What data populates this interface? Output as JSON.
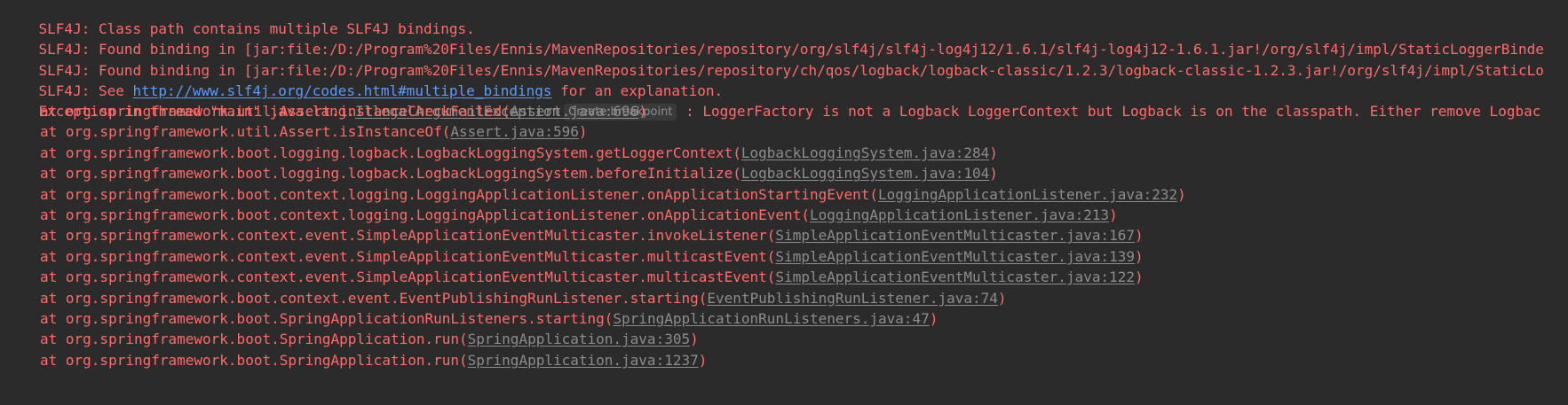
{
  "console": {
    "slf4j_lines": [
      "SLF4J: Class path contains multiple SLF4J bindings.",
      "SLF4J: Found binding in [jar:file:/D:/Program%20Files/Ennis/MavenRepositories/repository/org/slf4j/slf4j-log4j12/1.6.1/slf4j-log4j12-1.6.1.jar!/org/slf4j/impl/StaticLoggerBinde",
      "SLF4J: Found binding in [jar:file:/D:/Program%20Files/Ennis/MavenRepositories/repository/ch/qos/logback/logback-classic/1.2.3/logback-classic-1.2.3.jar!/org/slf4j/impl/StaticLo"
    ],
    "see_line": {
      "prefix": "SLF4J: See ",
      "url": "http://www.slf4j.org/codes.html#multiple_bindings",
      "suffix": " for an explanation."
    },
    "exception": {
      "prefix": "Exception in thread \"main\" java.lang.",
      "class_link": "IllegalArgumentException",
      "breakpoint_hint": "Create breakpoint",
      "message": " : LoggerFactory is not a Logback LoggerContext but Logback is on the classpath. Either remove Logbac"
    },
    "stack": [
      {
        "method": "at org.springframework.util.Assert.instanceCheckFailed(",
        "source": "Assert.java:696",
        "close": ")"
      },
      {
        "method": "at org.springframework.util.Assert.isInstanceOf(",
        "source": "Assert.java:596",
        "close": ")"
      },
      {
        "method": "at org.springframework.boot.logging.logback.LogbackLoggingSystem.getLoggerContext(",
        "source": "LogbackLoggingSystem.java:284",
        "close": ")"
      },
      {
        "method": "at org.springframework.boot.logging.logback.LogbackLoggingSystem.beforeInitialize(",
        "source": "LogbackLoggingSystem.java:104",
        "close": ")"
      },
      {
        "method": "at org.springframework.boot.context.logging.LoggingApplicationListener.onApplicationStartingEvent(",
        "source": "LoggingApplicationListener.java:232",
        "close": ")"
      },
      {
        "method": "at org.springframework.boot.context.logging.LoggingApplicationListener.onApplicationEvent(",
        "source": "LoggingApplicationListener.java:213",
        "close": ")"
      },
      {
        "method": "at org.springframework.context.event.SimpleApplicationEventMulticaster.invokeListener(",
        "source": "SimpleApplicationEventMulticaster.java:167",
        "close": ")"
      },
      {
        "method": "at org.springframework.context.event.SimpleApplicationEventMulticaster.multicastEvent(",
        "source": "SimpleApplicationEventMulticaster.java:139",
        "close": ")"
      },
      {
        "method": "at org.springframework.context.event.SimpleApplicationEventMulticaster.multicastEvent(",
        "source": "SimpleApplicationEventMulticaster.java:122",
        "close": ")"
      },
      {
        "method": "at org.springframework.boot.context.event.EventPublishingRunListener.starting(",
        "source": "EventPublishingRunListener.java:74",
        "close": ")"
      },
      {
        "method": "at org.springframework.boot.SpringApplicationRunListeners.starting(",
        "source": "SpringApplicationRunListeners.java:47",
        "close": ")"
      },
      {
        "method": "at org.springframework.boot.SpringApplication.run(",
        "source": "SpringApplication.java:305",
        "close": ")"
      },
      {
        "method": "at org.springframework.boot.SpringApplication.run(",
        "source": "SpringApplication.java:1237",
        "close": ")"
      }
    ],
    "colors": {
      "background": "#2b2b2b",
      "error_text": "#ff6b68",
      "hyperlink": "#589df6",
      "source_link": "#8c8c8c",
      "hint_background": "#3a3a3a"
    }
  }
}
